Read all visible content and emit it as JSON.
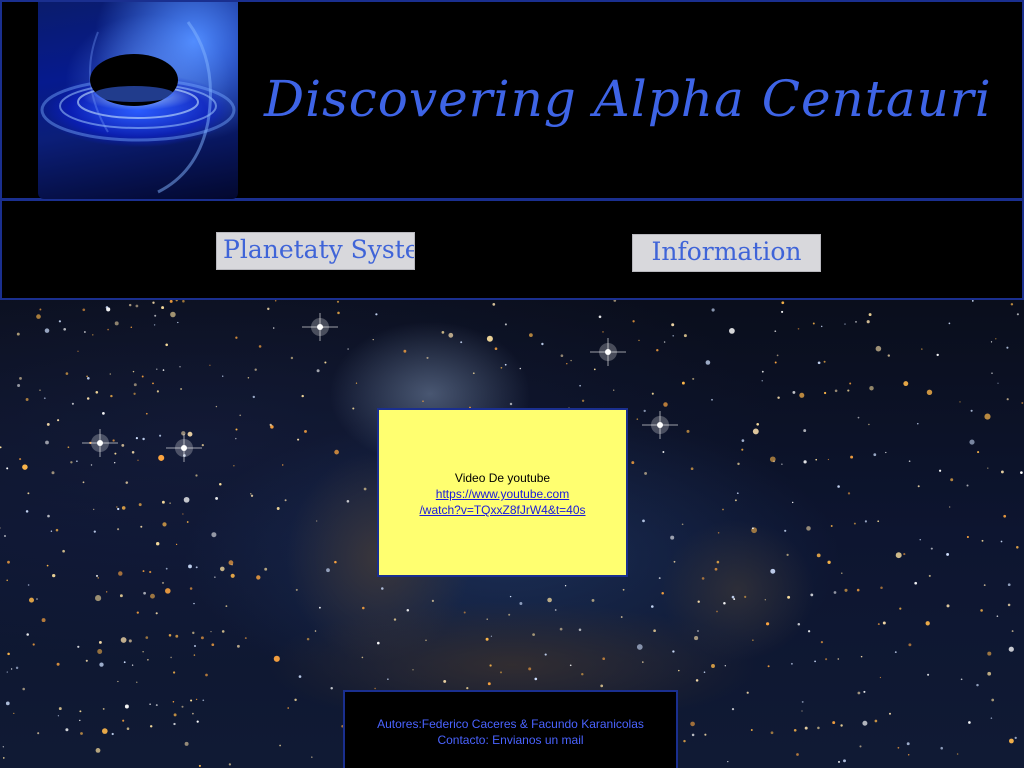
{
  "header": {
    "title": "Discovering Alpha Centauri",
    "logo": "black-hole-image"
  },
  "nav": {
    "items": [
      {
        "label": "Planetaty System"
      },
      {
        "label": "Information"
      }
    ]
  },
  "video": {
    "caption": "Video De youtube",
    "link_line1": "https://www.youtube.com",
    "link_line2": "/watch?v=TQxxZ8fJrW4&t=40s"
  },
  "footer": {
    "authors": "Autores:Federico Caceres & Facundo Karanicolas",
    "contact_prefix": "Contacto: ",
    "contact_link": "Envianos un mail"
  },
  "colors": {
    "title": "#3e64e6",
    "border": "#1a2f8f",
    "video_bg": "#ffff70",
    "footer_text": "#4a63ff"
  }
}
